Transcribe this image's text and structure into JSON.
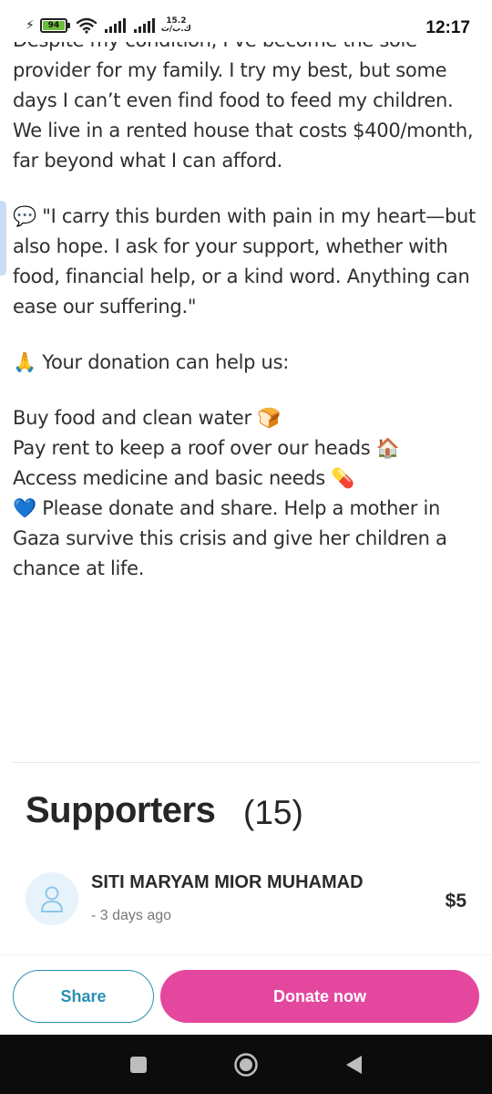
{
  "status_bar": {
    "battery": "94",
    "network_speed_value": "15.2",
    "network_speed_unit": "ك.ب/ث",
    "time": "12:17"
  },
  "story": {
    "paragraph1_lines": [
      "Despite my condition, I’ve become the sole",
      "provider for my family. I try my best, but some",
      "days I can’t even find food to feed my children.",
      "We live in a rented house that costs $400/month,",
      "far beyond what I can afford."
    ],
    "quote_lines": [
      "💬 \"I carry this burden with pain in my heart—but",
      "also hope. I ask for your support, whether with",
      "food, financial help, or a kind word. Anything can",
      "ease our suffering.\""
    ],
    "donation_intro": "🙏 Your donation can help us:",
    "list_lines": [
      "Buy food and clean water 🍞",
      "Pay rent to keep a roof over our heads 🏠",
      "Access medicine and basic needs 💊",
      "💙 Please donate and share. Help a mother in",
      "Gaza survive this crisis and give her children a",
      "chance at life."
    ]
  },
  "supporters": {
    "title": "Supporters",
    "count": "(15)",
    "items": [
      {
        "name": "SITI MARYAM MIOR MUHAMAD",
        "meta": "-  3 days ago",
        "amount": "$5",
        "avatar_icon": "user-icon"
      }
    ]
  },
  "actions": {
    "share_label": "Share",
    "donate_label": "Donate now"
  },
  "colors": {
    "share_accent": "#2a8fb5",
    "donate_bg": "#e4479e",
    "battery_fill": "#6bbd3b"
  },
  "nav": {
    "icons": [
      "square-recents-icon",
      "circle-home-icon",
      "triangle-back-icon"
    ]
  }
}
